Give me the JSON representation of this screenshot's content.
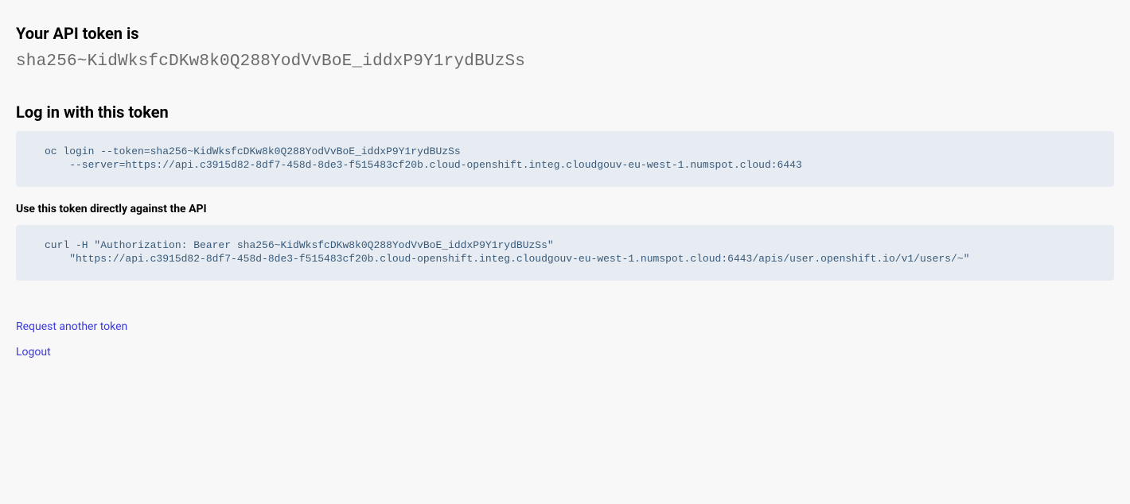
{
  "header": {
    "token_label": "Your API token is",
    "token_value": "sha256~KidWksfcDKw8k0Q288YodVvBoE_iddxP9Y1rydBUzSs"
  },
  "login_section": {
    "heading": "Log in with this token",
    "command": "oc login --token=sha256~KidWksfcDKw8k0Q288YodVvBoE_iddxP9Y1rydBUzSs\n    --server=https://api.c3915d82-8df7-458d-8de3-f515483cf20b.cloud-openshift.integ.cloudgouv-eu-west-1.numspot.cloud:6443"
  },
  "api_section": {
    "heading": "Use this token directly against the API",
    "command": "curl -H \"Authorization: Bearer sha256~KidWksfcDKw8k0Q288YodVvBoE_iddxP9Y1rydBUzSs\"\n    \"https://api.c3915d82-8df7-458d-8de3-f515483cf20b.cloud-openshift.integ.cloudgouv-eu-west-1.numspot.cloud:6443/apis/user.openshift.io/v1/users/~\""
  },
  "links": {
    "request_another": "Request another token",
    "logout": "Logout"
  }
}
